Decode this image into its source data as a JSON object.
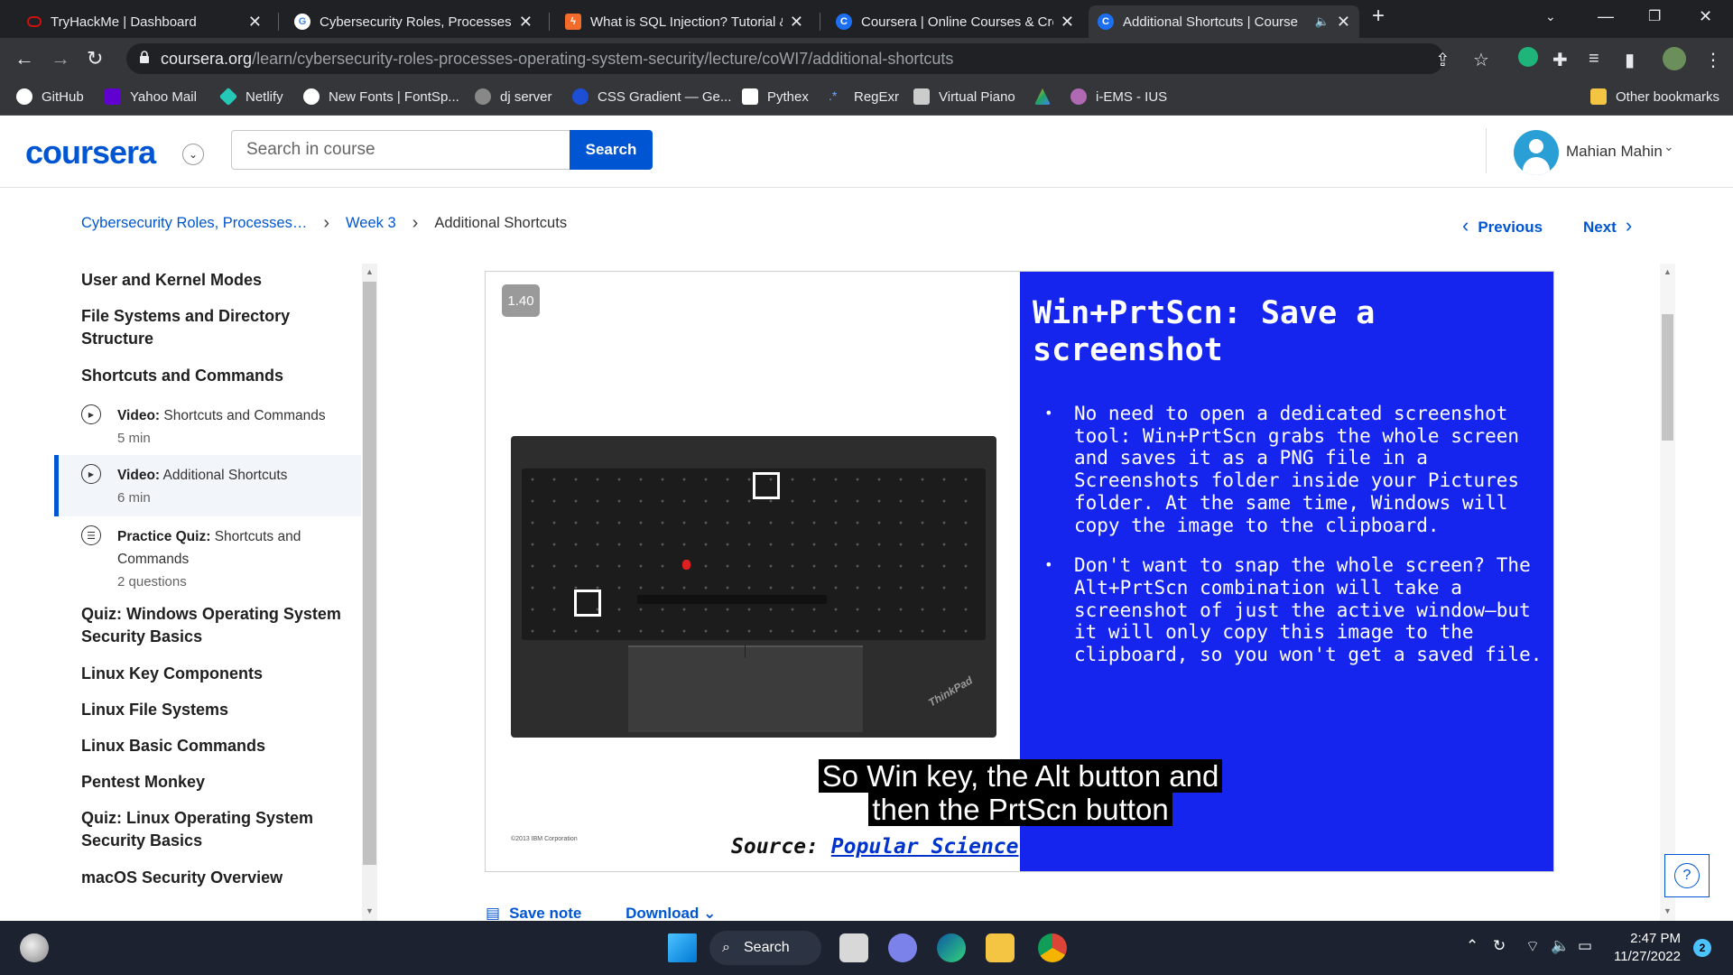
{
  "browser": {
    "tabs": [
      {
        "title": "TryHackMe | Dashboard",
        "icon": "tryhackme-icon"
      },
      {
        "title": "Cybersecurity Roles, Processes &",
        "icon": "google-icon"
      },
      {
        "title": "What is SQL Injection? Tutorial &",
        "icon": "lightning-icon"
      },
      {
        "title": "Coursera | Online Courses & Cred",
        "icon": "coursera-icon"
      },
      {
        "title": "Additional Shortcuts | Course",
        "icon": "coursera-icon"
      }
    ],
    "url_host": "coursera.org",
    "url_path": "/learn/cybersecurity-roles-processes-operating-system-security/lecture/coWI7/additional-shortcuts",
    "bookmarks": [
      "GitHub",
      "Yahoo Mail",
      "Netlify",
      "New Fonts | FontSp...",
      "dj server",
      "CSS Gradient — Ge...",
      "Pythex",
      "RegExr",
      "Virtual Piano",
      "",
      "i-EMS - IUS"
    ],
    "other_bookmarks": "Other bookmarks"
  },
  "header": {
    "logo": "coursera",
    "search_placeholder": "Search in course",
    "search_button": "Search",
    "user_name": "Mahian Mahin"
  },
  "breadcrumb": {
    "course": "Cybersecurity Roles, Processes…",
    "week": "Week 3",
    "current": "Additional Shortcuts"
  },
  "nav": {
    "previous": "Previous",
    "next": "Next"
  },
  "sidebar": {
    "items": [
      "User and Kernel Modes",
      "File Systems and Directory Structure",
      "Shortcuts and Commands"
    ],
    "sub_items": [
      {
        "kind": "Video:",
        "title": "Shortcuts and Commands",
        "meta": "5 min"
      },
      {
        "kind": "Video:",
        "title": "Additional Shortcuts",
        "meta": "6 min"
      },
      {
        "kind": "Practice Quiz:",
        "title": "Shortcuts and Commands",
        "meta": "2 questions"
      }
    ],
    "items_after": [
      "Quiz: Windows Operating System Security Basics",
      "Linux Key Components",
      "Linux File Systems",
      "Linux Basic Commands",
      "Pentest Monkey",
      "Quiz: Linux Operating System Security Basics",
      "macOS Security Overview"
    ]
  },
  "video": {
    "speed": "1.40",
    "slide_title": "Win+PrtScn: Save a screenshot",
    "bullets": [
      "No need to open a dedicated screenshot tool: Win+PrtScn grabs the whole screen and saves it as a PNG file in a Screenshots folder inside your Pictures folder. At the same time, Windows will copy the image to the clipboard.",
      "Don't want to snap the whole screen? The Alt+PrtScn combination will take a screenshot of just the active window—but it will only copy this image to the clipboard, so you won't get a saved file."
    ],
    "source_label": "Source:",
    "source_link": "Popular Science",
    "copyright": "©2013 IBM Corporation",
    "laptop_brand": "ThinkPad",
    "captions": [
      "So Win key, the Alt button and",
      "then the PrtScn button"
    ]
  },
  "below_video": {
    "save_note": "Save note",
    "download": "Download"
  },
  "taskbar": {
    "search": "Search",
    "time": "2:47 PM",
    "date": "11/27/2022",
    "notifications": "2"
  }
}
